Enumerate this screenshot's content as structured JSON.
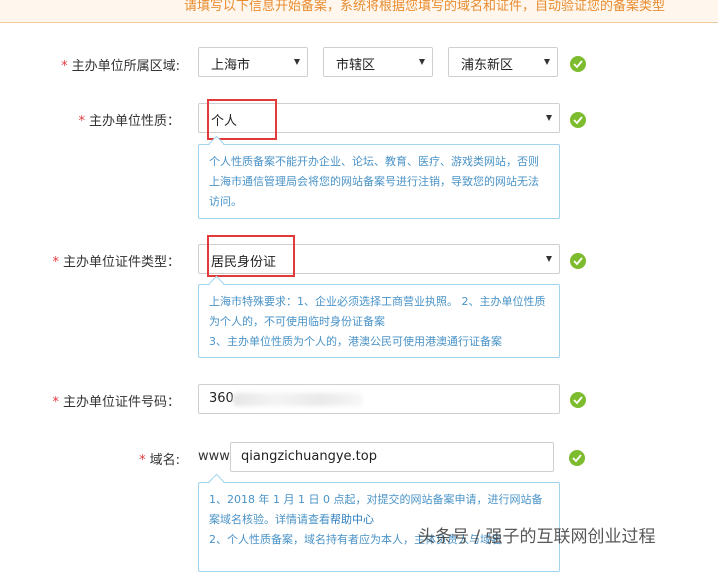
{
  "banner": {
    "text": "请填写以下信息开始备案，系统将根据您填写的域名和证件，自动验证您的备案类型"
  },
  "required_mark": "*",
  "region": {
    "label": "主办单位所属区域:",
    "province": "上海市",
    "city": "市辖区",
    "district": "浦东新区"
  },
  "nature": {
    "label": "主办单位性质：",
    "value": "个人",
    "hint": "个人性质备案不能开办企业、论坛、教育、医疗、游戏类网站，否则上海市通信管理局会将您的网站备案号进行注销，导致您的网站无法访问。"
  },
  "cert_type": {
    "label": "主办单位证件类型：",
    "value": "居民身份证",
    "hint_line1": "上海市特殊要求：1、企业必须选择工商营业执照。 2、主办单位性质为个人的，不可使用临时身份证备案",
    "hint_line2": "3、主办单位性质为个人的，港澳公民可使用港澳通行证备案"
  },
  "cert_number": {
    "label": "主办单位证件号码：",
    "value": "360"
  },
  "domain": {
    "label": "域名:",
    "prefix": "www.",
    "value": "qiangzichuangye.top",
    "hint_line1": "1、2018 年 1 月 1 日 0 点起，对提交的网站备案申请，进行网站备案域名核验。详情请查看",
    "help_link": "帮助中心",
    "hint_line2": "2、个人性质备案，域名持有者应为本人，主体负责人与域名"
  },
  "watermark": "头条号 / 强子的互联网创业过程",
  "colors": {
    "check": "#7dbb2f",
    "highlight": "#e23a3a",
    "hint_text": "#4a93c7",
    "banner_text": "#e98c2f"
  }
}
